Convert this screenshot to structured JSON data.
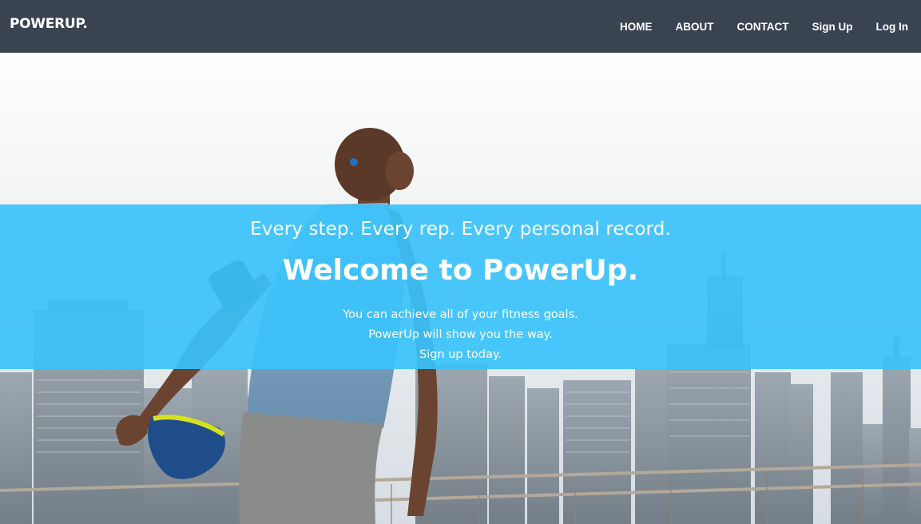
{
  "navbar": {
    "brand": "POWERUP.",
    "links": [
      "HOME",
      "ABOUT",
      "CONTACT",
      "Sign Up",
      "Log In"
    ]
  },
  "hero": {
    "tagline": "Every step. Every rep. Every personal record.",
    "headline": "Welcome to PowerUp.",
    "lines": [
      "You can achieve all of your fitness goals.",
      "PowerUp will show you the way.",
      "Sign up today."
    ],
    "image": "runner-stretching-city-skyline",
    "band_color": "#3ac2fc"
  },
  "colors": {
    "navbar_bg": "#3a4350",
    "text": "#ffffff"
  }
}
